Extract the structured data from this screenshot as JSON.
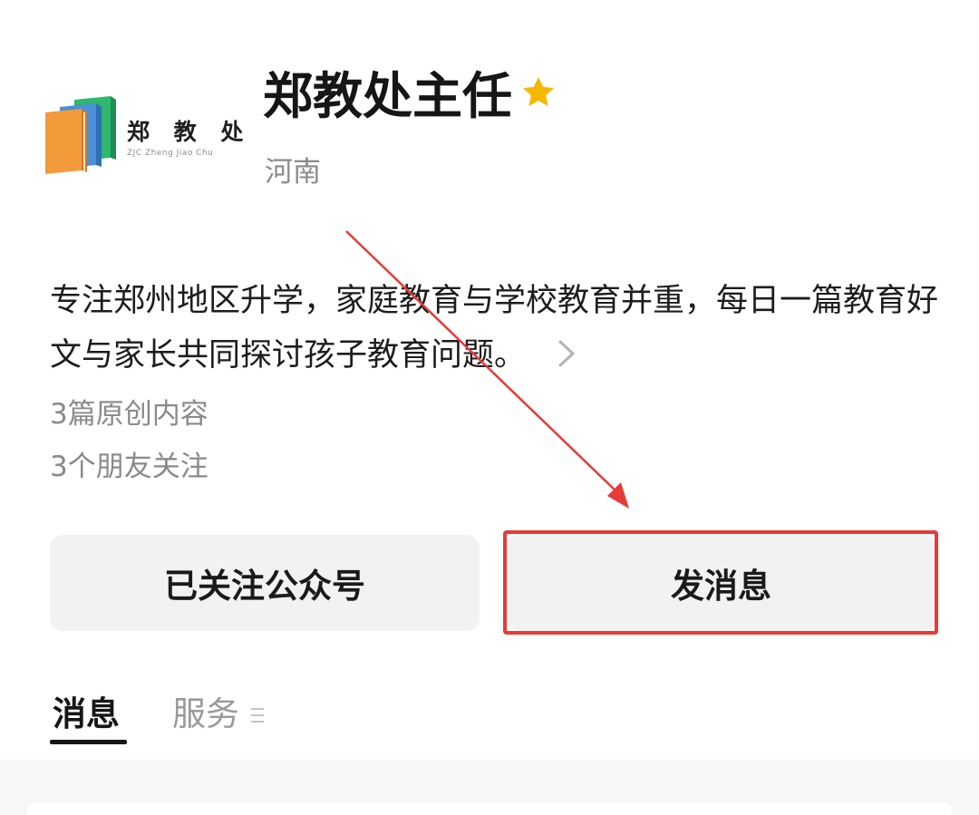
{
  "account": {
    "name": "郑教处主任",
    "region": "河南",
    "logo_text": "郑 教 处",
    "logo_subtext": "ZJC Zheng Jiao Chu",
    "description": "专注郑州地区升学，家庭教育与学校教育并重，每日一篇教育好文与家长共同探讨孩子教育问题。",
    "original_count": "3篇原创内容",
    "friends_following": "3个朋友关注"
  },
  "buttons": {
    "follow_label": "已关注公众号",
    "message_label": "发消息"
  },
  "tabs": [
    {
      "label": "消息",
      "active": true
    },
    {
      "label": "服务",
      "active": false
    }
  ],
  "icons": {
    "star": "star-icon",
    "chevron": "chevron-right-icon",
    "menu": "menu-lines-icon"
  },
  "colors": {
    "star": "#f5b800",
    "highlight": "#e63b37",
    "button_bg": "#f2f2f2",
    "secondary_text": "#8a8a8a"
  }
}
